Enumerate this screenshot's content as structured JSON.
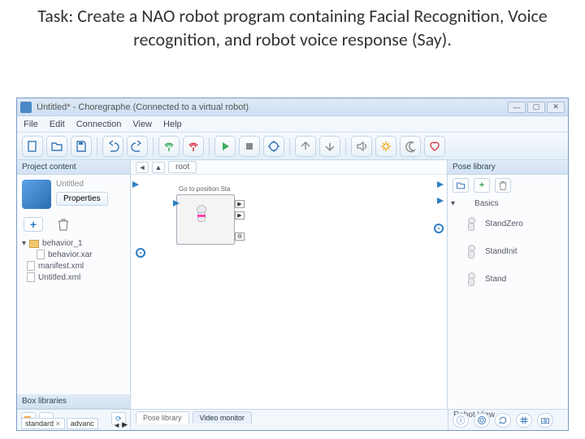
{
  "task": {
    "heading": "Task: Create a NAO robot program containing Facial Recognition, Voice recognition, and robot voice response (Say)."
  },
  "window": {
    "title": "Untitled* - Choregraphe (Connected to a virtual robot)"
  },
  "menu": {
    "file": "File",
    "edit": "Edit",
    "connection": "Connection",
    "view": "View",
    "help": "Help"
  },
  "project": {
    "header": "Project content",
    "name": "Untitled",
    "properties": "Properties",
    "tree": {
      "behavior1": "behavior_1",
      "behaviorxar": "behavior.xar",
      "manifest": "manifest.xml",
      "untitledxml": "Untitled.xml"
    }
  },
  "breadcrumb": {
    "root": "root"
  },
  "canvas": {
    "node1_label": "Go to position Sta"
  },
  "poselib": {
    "header": "Pose library",
    "basics": "Basics",
    "standzero": "StandZero",
    "standinit": "StandInit",
    "stand": "Stand"
  },
  "boxlib": {
    "header": "Box libraries",
    "tab1": "standard",
    "tab2": "advanc"
  },
  "bottomtabs": {
    "pose": "Pose library",
    "video": "Video monitor"
  },
  "robotview": {
    "label": "Robot View"
  }
}
